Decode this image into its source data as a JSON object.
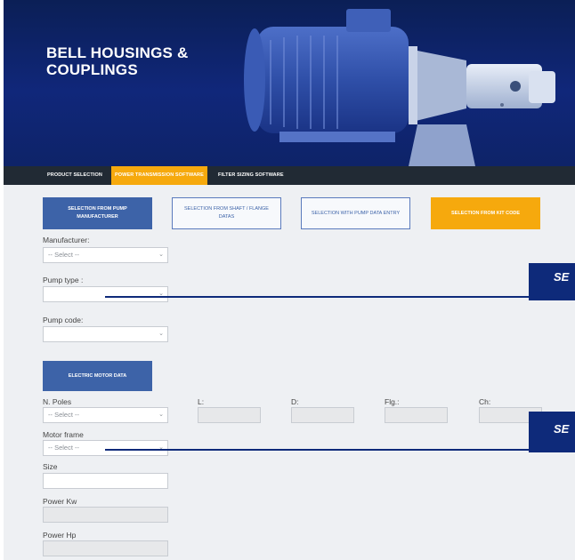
{
  "hero": {
    "title": "BELL HOUSINGS & COUPLINGS"
  },
  "nav": {
    "items": [
      {
        "label": "PRODUCT SELECTION"
      },
      {
        "label": "POWER TRANSMISSION SOFTWARE"
      },
      {
        "label": "FILTER SIZING SOFTWARE"
      }
    ],
    "active_index": 1
  },
  "selection_buttons": [
    {
      "label": "SELECTION FROM PUMP MANUFACTURER"
    },
    {
      "label": "SELECTION FROM SHAFT / FLANGE DATAS"
    },
    {
      "label": "SELECTION WITH PUMP DATA ENTRY"
    },
    {
      "label": "SELECTION FROM KIT CODE"
    }
  ],
  "pump_form": {
    "manufacturer_label": "Manufacturer:",
    "manufacturer_value": "-- Select --",
    "pump_type_label": "Pump type :",
    "pump_type_value": "",
    "pump_code_label": "Pump code:",
    "pump_code_value": ""
  },
  "motor": {
    "button_label": "ELECTRIC MOTOR DATA",
    "poles_label": "N. Poles",
    "poles_value": "-- Select --",
    "frame_label": "Motor frame",
    "frame_value": "-- Select --",
    "size_label": "Size",
    "power_kw_label": "Power Kw",
    "power_hp_label": "Power Hp",
    "dim_labels": {
      "l": "L:",
      "d": "D:",
      "flg": "Flg.:",
      "ch": "Ch:"
    }
  },
  "callouts": [
    {
      "text": "SE"
    },
    {
      "text": "SE"
    }
  ],
  "colors": {
    "hero_blue": "#10277a",
    "nav_dark": "#212a34",
    "accent_orange": "#f6a90d",
    "button_blue": "#3d63a8",
    "callout_navy": "#0e2a7a"
  }
}
